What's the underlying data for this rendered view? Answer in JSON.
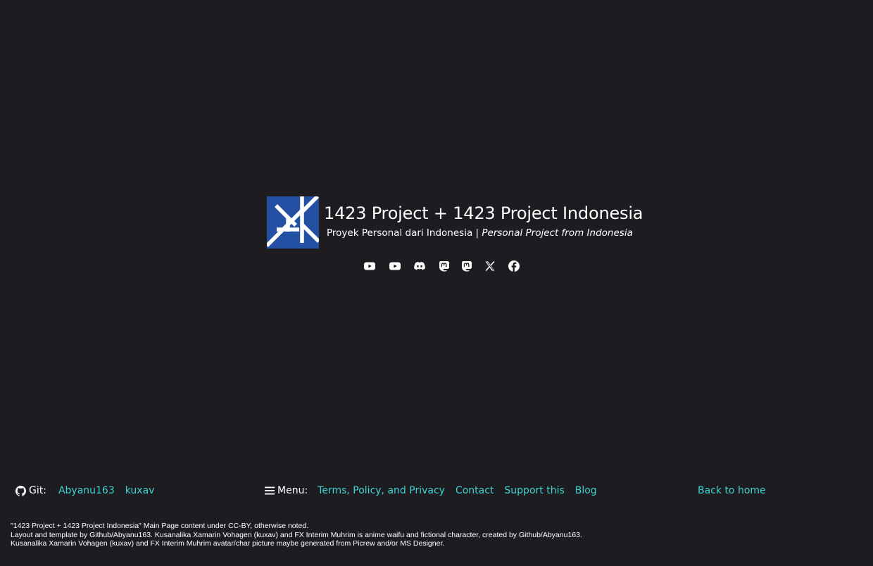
{
  "header": {
    "title": "1423 Project + 1423 Project Indonesia",
    "subtitle_id": "Proyek Personal dari Indonesia",
    "subtitle_sep": " | ",
    "subtitle_en": "Personal Project from Indonesia",
    "logo_color": "#2350a3"
  },
  "social": [
    {
      "icon": "youtube-icon"
    },
    {
      "icon": "youtube-icon"
    },
    {
      "icon": "discord-icon"
    },
    {
      "icon": "mastodon-icon"
    },
    {
      "icon": "mastodon-icon"
    },
    {
      "icon": "x-twitter-icon"
    },
    {
      "icon": "facebook-icon"
    }
  ],
  "footer": {
    "git_label": "Git:",
    "git_links": [
      "Abyanu163",
      "kuxav"
    ],
    "menu_label": "Menu:",
    "menu_links": [
      "Terms, Policy, and Privacy",
      "Contact",
      "Support this",
      "Blog"
    ],
    "back_home": "Back to home",
    "link_color": "#3fd3d3"
  },
  "legal": [
    "\"1423 Project + 1423 Project Indonesia\" Main Page content under CC-BY, otherwise noted.",
    "Layout and template by Github/Abyanu163. Kusanalika Xamarin Vohagen (kuxav) and FX Interim Muhrim is anime waifu and fictional character, created by Github/Abyanu163.",
    "Kusanalika Xamarin Vohagen (kuxav) and FX Interim Muhrim avatar/char picture maybe generated from Picrew and/or MS Designer."
  ]
}
